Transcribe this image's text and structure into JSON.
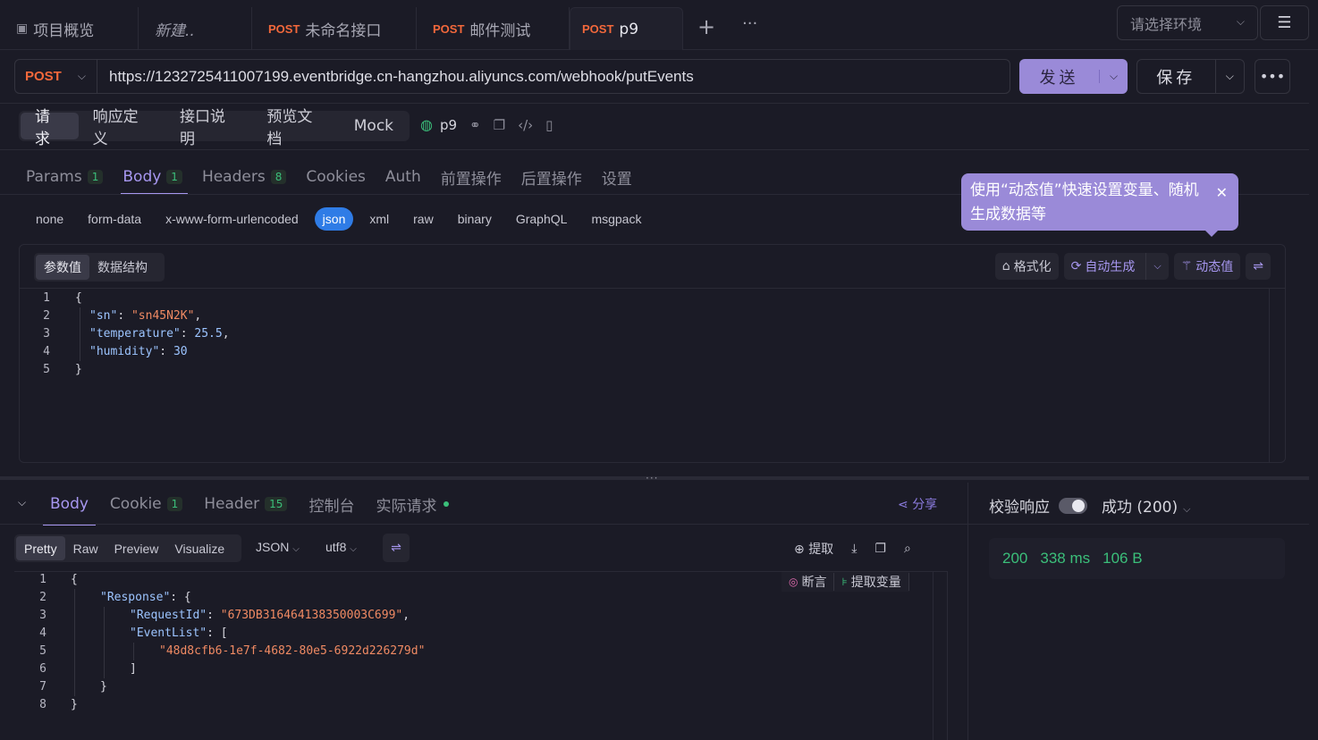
{
  "tabs": [
    {
      "label": "项目概览",
      "method": "",
      "icon": "box-icon"
    },
    {
      "label": "新建..",
      "method": ""
    },
    {
      "label": "未命名接口",
      "method": "POST"
    },
    {
      "label": "邮件测试",
      "method": "POST"
    },
    {
      "label": "p9",
      "method": "POST",
      "active": true
    }
  ],
  "env_placeholder": "请选择环境",
  "request": {
    "method": "POST",
    "url": "https://1232725411007199.eventbridge.cn-hangzhou.aliyuncs.com/webhook/putEvents",
    "send_label": "发送",
    "save_label": "保存"
  },
  "segments": [
    "请求",
    "响应定义",
    "接口说明",
    "预览文档",
    "Mock"
  ],
  "api_name": "p9",
  "subtabs": [
    {
      "label": "Params",
      "count": "1"
    },
    {
      "label": "Body",
      "count": "1"
    },
    {
      "label": "Headers",
      "count": "8"
    },
    {
      "label": "Cookies",
      "count": ""
    },
    {
      "label": "Auth",
      "count": ""
    },
    {
      "label": "前置操作",
      "count": ""
    },
    {
      "label": "后置操作",
      "count": ""
    },
    {
      "label": "设置",
      "count": ""
    }
  ],
  "body_types": [
    "none",
    "form-data",
    "x-www-form-urlencoded",
    "json",
    "xml",
    "raw",
    "binary",
    "GraphQL",
    "msgpack"
  ],
  "tooltip": {
    "line1": "使用“动态值”快速设置变量、随机",
    "line2": "生成数据等"
  },
  "editor": {
    "tabs": [
      "参数值",
      "数据结构"
    ],
    "format_label": "格式化",
    "autogen_label": "自动生成",
    "dynamic_label": "动态值",
    "lines": [
      {
        "n": "1",
        "text": "{"
      },
      {
        "n": "2",
        "key": "\"sn\"",
        "val": "\"sn45N2K\"",
        "tail": ","
      },
      {
        "n": "3",
        "key": "\"temperature\"",
        "num": "25.5",
        "tail": ","
      },
      {
        "n": "4",
        "key": "\"humidity\"",
        "num": "30",
        "tail": ""
      },
      {
        "n": "5",
        "text": "}"
      }
    ]
  },
  "response": {
    "tabs": [
      {
        "label": "Body",
        "count": ""
      },
      {
        "label": "Cookie",
        "count": "1"
      },
      {
        "label": "Header",
        "count": "15"
      },
      {
        "label": "控制台",
        "count": ""
      },
      {
        "label": "实际请求",
        "count": ""
      }
    ],
    "share_label": "分享",
    "formats": [
      "Pretty",
      "Raw",
      "Preview",
      "Visualize"
    ],
    "lang": "JSON",
    "encoding": "utf8",
    "extract_label": "提取",
    "assert_label": "断言",
    "extract_var_label": "提取变量",
    "lines": [
      {
        "n": "1",
        "indent": 0,
        "text": "{"
      },
      {
        "n": "2",
        "indent": 1,
        "key": "\"Response\"",
        "tail": ": {"
      },
      {
        "n": "3",
        "indent": 2,
        "key": "\"RequestId\"",
        "val": "\"673DB316464138350003C699\"",
        "tail": ","
      },
      {
        "n": "4",
        "indent": 2,
        "key": "\"EventList\"",
        "tail": ": ["
      },
      {
        "n": "5",
        "indent": 3,
        "val": "\"48d8cfb6-1e7f-4682-80e5-6922d226279d\""
      },
      {
        "n": "6",
        "indent": 2,
        "text": "]"
      },
      {
        "n": "7",
        "indent": 1,
        "text": "}"
      },
      {
        "n": "8",
        "indent": 0,
        "text": "}"
      }
    ],
    "verify_label": "校验响应",
    "status_label": "成功 (200)",
    "stats": {
      "code": "200",
      "time": "338 ms",
      "size": "106 B"
    }
  }
}
